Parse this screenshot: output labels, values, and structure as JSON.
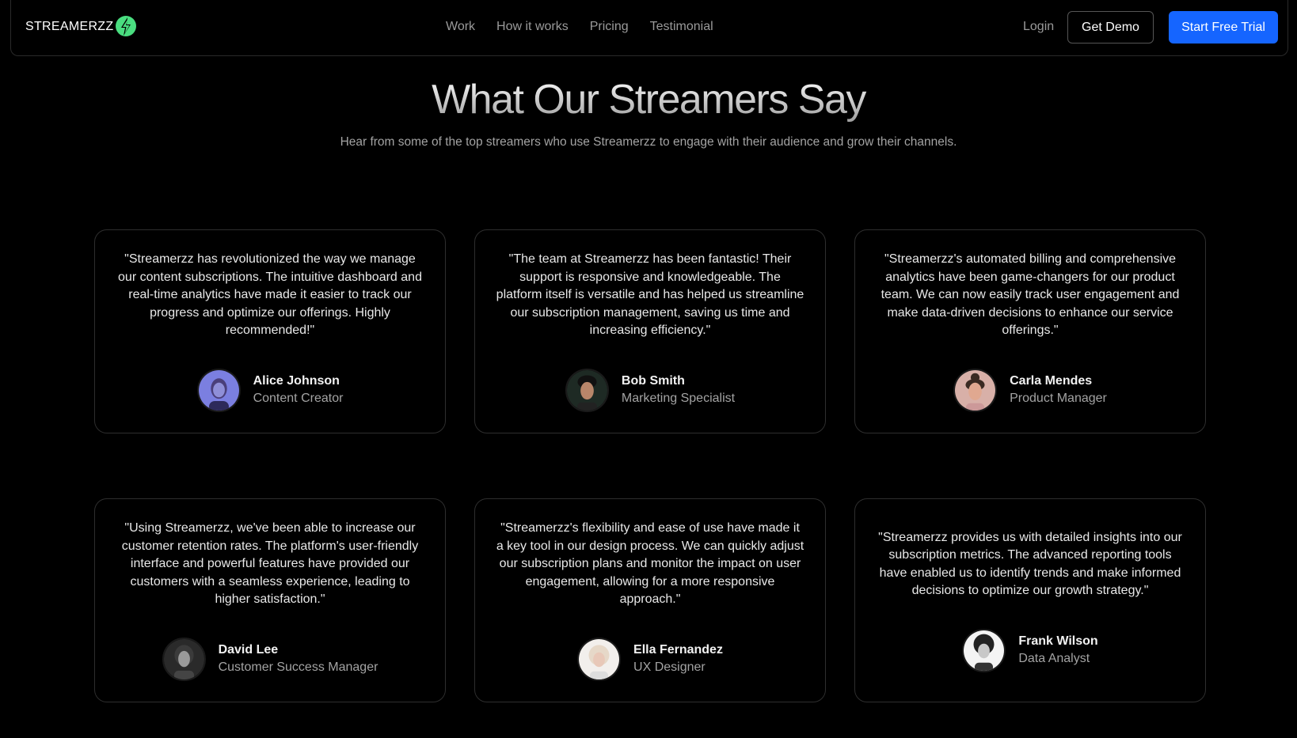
{
  "nav": {
    "logo_text": "STREAMERZZ",
    "links": [
      "Work",
      "How it works",
      "Pricing",
      "Testimonial"
    ],
    "login": "Login",
    "demo": "Get Demo",
    "trial": "Start Free Trial",
    "accent_color": "#1565ff",
    "logo_color": "#4ade80"
  },
  "section": {
    "title": "What Our Streamers Say",
    "subtitle": "Hear from some of the top streamers who use Streamerzz to engage with their audience and grow their channels."
  },
  "testimonials": [
    {
      "quote": "\"Streamerzz has revolutionized the way we manage our content subscriptions. The intuitive dashboard and real-time analytics have made it easier to track our progress and optimize our offerings. Highly recommended!\"",
      "name": "Alice Johnson",
      "role": "Content Creator"
    },
    {
      "quote": "\"The team at Streamerzz has been fantastic! Their support is responsive and knowledgeable. The platform itself is versatile and has helped us streamline our subscription management, saving us time and increasing efficiency.\"",
      "name": "Bob Smith",
      "role": "Marketing Specialist"
    },
    {
      "quote": "\"Streamerzz's automated billing and comprehensive analytics have been game-changers for our product team. We can now easily track user engagement and make data-driven decisions to enhance our service offerings.\"",
      "name": "Carla Mendes",
      "role": "Product Manager"
    },
    {
      "quote": "\"Using Streamerzz, we've been able to increase our customer retention rates. The platform's user-friendly interface and powerful features have provided our customers with a seamless experience, leading to higher satisfaction.\"",
      "name": "David Lee",
      "role": "Customer Success Manager"
    },
    {
      "quote": "\"Streamerzz's flexibility and ease of use have made it a key tool in our design process. We can quickly adjust our subscription plans and monitor the impact on user engagement, allowing for a more responsive approach.\"",
      "name": "Ella Fernandez",
      "role": "UX Designer"
    },
    {
      "quote": "\"Streamerzz provides us with detailed insights into our subscription metrics. The advanced reporting tools have enabled us to identify trends and make informed decisions to optimize our growth strategy.\"",
      "name": "Frank Wilson",
      "role": "Data Analyst"
    }
  ]
}
